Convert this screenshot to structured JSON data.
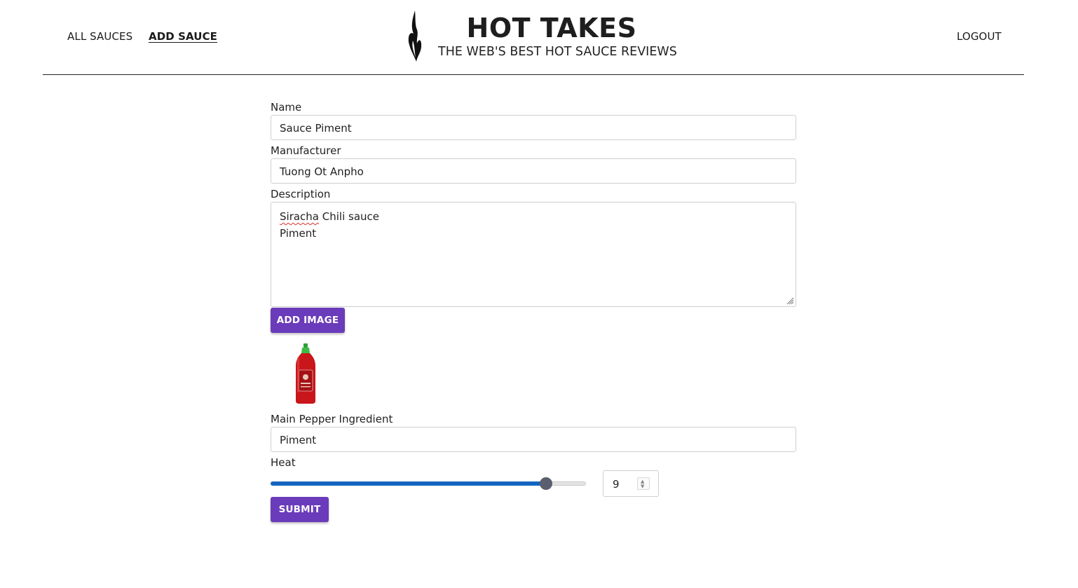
{
  "nav": {
    "all_sauces": "ALL SAUCES",
    "add_sauce": "ADD SAUCE",
    "logout": "LOGOUT"
  },
  "brand": {
    "title": "HOT TAKES",
    "subtitle": "THE WEB'S BEST HOT SAUCE REVIEWS",
    "logo_icon": "flame-icon"
  },
  "form": {
    "name": {
      "label": "Name",
      "value": "Sauce Piment"
    },
    "manufacturer": {
      "label": "Manufacturer",
      "value": "Tuong Ot Anpho"
    },
    "description": {
      "label": "Description",
      "line1_misspelled": "Siracha",
      "line1_rest": " Chili sauce",
      "line2": "Piment"
    },
    "add_image_label": "ADD IMAGE",
    "image_preview_icon": "hot-sauce-bottle-image",
    "main_pepper": {
      "label": "Main Pepper Ingredient",
      "value": "Piment"
    },
    "heat": {
      "label": "Heat",
      "value": "9",
      "min": 1,
      "max": 10
    },
    "submit_label": "SUBMIT"
  },
  "colors": {
    "accent": "#6a3bba",
    "slider_fill": "#1565c0",
    "slider_thumb": "#5a5e6e"
  }
}
